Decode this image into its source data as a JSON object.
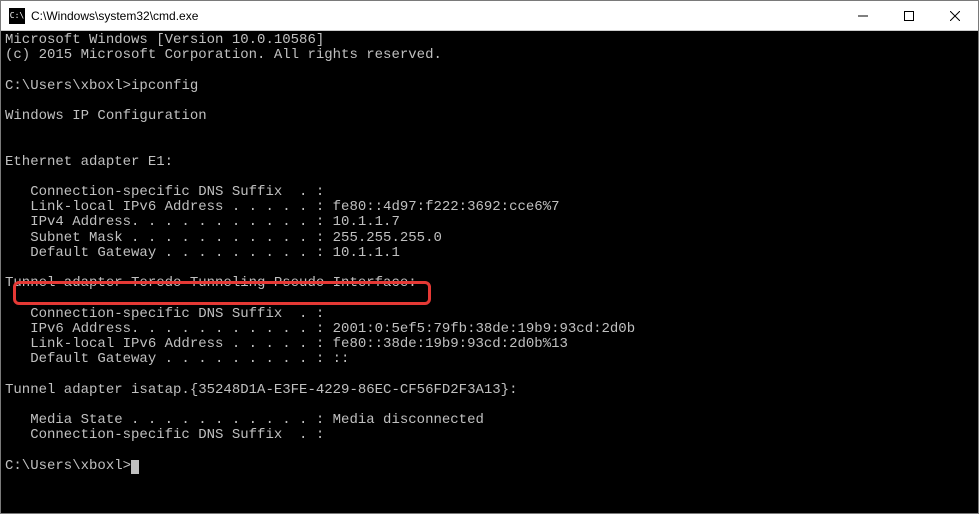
{
  "titlebar": {
    "icon_label": "C:\\",
    "title": "C:\\Windows\\system32\\cmd.exe"
  },
  "terminal": {
    "line_header1": "Microsoft Windows [Version 10.0.10586]",
    "line_header2": "(c) 2015 Microsoft Corporation. All rights reserved.",
    "prompt1": "C:\\Users\\xboxl>",
    "command1": "ipconfig",
    "ipcfg_title": "Windows IP Configuration",
    "adapter1": {
      "title": "Ethernet adapter E1:",
      "dns_suffix": "   Connection-specific DNS Suffix  . :",
      "link_local_v6": "   Link-local IPv6 Address . . . . . : fe80::4d97:f222:3692:cce6%7",
      "ipv4": "   IPv4 Address. . . . . . . . . . . : 10.1.1.7",
      "subnet": "   Subnet Mask . . . . . . . . . . . : 255.255.255.0",
      "gateway": "   Default Gateway . . . . . . . . . : 10.1.1.1"
    },
    "adapter2": {
      "title": "Tunnel adapter Teredo Tunneling Pseudo-Interface:",
      "dns_suffix": "   Connection-specific DNS Suffix  . :",
      "ipv6": "   IPv6 Address. . . . . . . . . . . : 2001:0:5ef5:79fb:38de:19b9:93cd:2d0b",
      "link_local_v6": "   Link-local IPv6 Address . . . . . : fe80::38de:19b9:93cd:2d0b%13",
      "gateway": "   Default Gateway . . . . . . . . . : ::"
    },
    "adapter3": {
      "title": "Tunnel adapter isatap.{35248D1A-E3FE-4229-86EC-CF56FD2F3A13}:",
      "media_state": "   Media State . . . . . . . . . . . : Media disconnected",
      "dns_suffix": "   Connection-specific DNS Suffix  . :"
    },
    "prompt2": "C:\\Users\\xboxl>"
  }
}
